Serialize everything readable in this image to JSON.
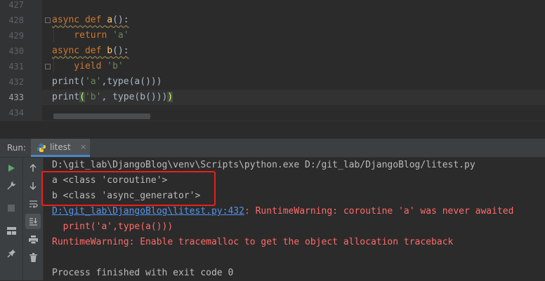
{
  "editor": {
    "line_numbers": [
      "427",
      "428",
      "429",
      "430",
      "431",
      "432",
      "433",
      "434"
    ],
    "current_line": "433",
    "lines": [
      {
        "num": "428",
        "tokens": [
          {
            "t": "async def ",
            "c": "kw"
          },
          {
            "t": "a",
            "c": "fn"
          },
          {
            "t": "():",
            "c": ""
          }
        ]
      },
      {
        "num": "429",
        "tokens": [
          {
            "t": "    return ",
            "c": "kw"
          },
          {
            "t": "'a'",
            "c": "str"
          }
        ]
      },
      {
        "num": "430",
        "tokens": [
          {
            "t": "async def ",
            "c": "kw"
          },
          {
            "t": "b",
            "c": "fn"
          },
          {
            "t": "():",
            "c": ""
          }
        ]
      },
      {
        "num": "431",
        "tokens": [
          {
            "t": "    yield ",
            "c": "kw"
          },
          {
            "t": "'b'",
            "c": "str"
          }
        ]
      },
      {
        "num": "432",
        "tokens": [
          {
            "t": "print(",
            "c": ""
          },
          {
            "t": "'a'",
            "c": "str"
          },
          {
            "t": ",type(a()))",
            "c": ""
          }
        ]
      },
      {
        "num": "433",
        "tokens": [
          {
            "t": "print",
            "c": ""
          },
          {
            "t": "(",
            "c": "bh"
          },
          {
            "t": "'b'",
            "c": "str"
          },
          {
            "t": ", type(b()))",
            "c": ""
          },
          {
            "t": ")",
            "c": "bh"
          }
        ]
      }
    ]
  },
  "run_panel": {
    "label": "Run:",
    "tab_label": "litest",
    "tab_close": "×",
    "icons": [
      "rerun-icon",
      "wrench-icon",
      "stop-icon",
      "layout-icon",
      "pin-icon",
      "up-arrow-icon",
      "down-arrow-icon",
      "soft-wrap-icon",
      "scroll-to-end-icon",
      "print-icon",
      "trash-icon"
    ]
  },
  "console": {
    "command": "D:\\git_lab\\DjangoBlog\\venv\\Scripts\\python.exe D:/git_lab/DjangoBlog/litest.py",
    "output_a": "a <class 'coroutine'>",
    "output_b": "b <class 'async_generator'>",
    "warning_link": "D:\\git_lab\\DjangoBlog\\litest.py:432",
    "warning_text": ": RuntimeWarning: coroutine 'a' was never awaited",
    "warning_source": "  print('a',type(a()))",
    "tracemalloc": "RuntimeWarning: Enable tracemalloc to get the object allocation traceback",
    "blank": "",
    "exit": "Process finished with exit code 0"
  },
  "colors": {
    "highlight_box": "#e8201c",
    "keyword": "#cc7832",
    "function": "#ffc66d",
    "string": "#6a8759",
    "error": "#ff6b68",
    "link": "#5394ec"
  }
}
